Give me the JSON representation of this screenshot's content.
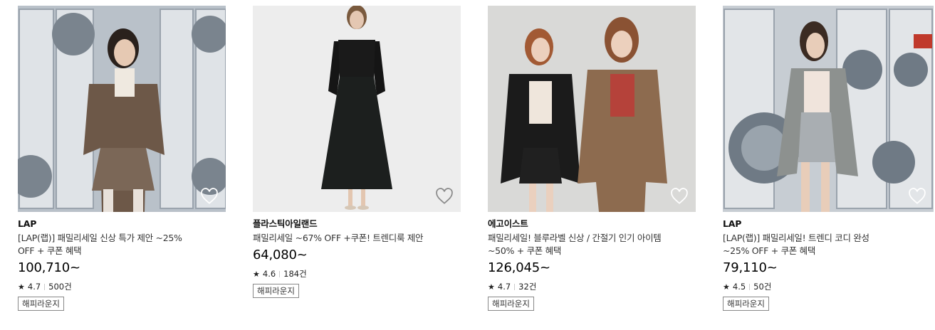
{
  "products": [
    {
      "brand": "LAP",
      "title": "[LAP(랩)] 패밀리세일 신상 특가 제안 ~25% OFF + 쿠폰 혜택",
      "price": "100,710~",
      "rating": "4.7",
      "reviews": "500건",
      "tag": "해피라운지"
    },
    {
      "brand": "플라스틱아일랜드",
      "title": "패밀리세일 ~67% OFF +쿠폰! 트렌디룩 제안",
      "price": "64,080~",
      "rating": "4.6",
      "reviews": "184건",
      "tag": "해피라운지"
    },
    {
      "brand": "에고이스트",
      "title": "패밀리세일! 블루라벨 신상 / 간절기 인기 아이템 ~50% + 쿠폰 혜택",
      "price": "126,045~",
      "rating": "4.7",
      "reviews": "32건",
      "tag": "해피라운지"
    },
    {
      "brand": "LAP",
      "title": "[LAP(랩)] 패밀리세일! 트렌디 코디 완성 ~25% OFF + 쿠폰 혜택",
      "price": "79,110~",
      "rating": "4.5",
      "reviews": "50건",
      "tag": "해피라운지"
    }
  ],
  "icons": {
    "wishlist": "heart-outline-icon",
    "rating": "star-icon"
  },
  "colors": {
    "heart": "#ffffff",
    "text": "#111111",
    "tag_border": "#888888"
  }
}
